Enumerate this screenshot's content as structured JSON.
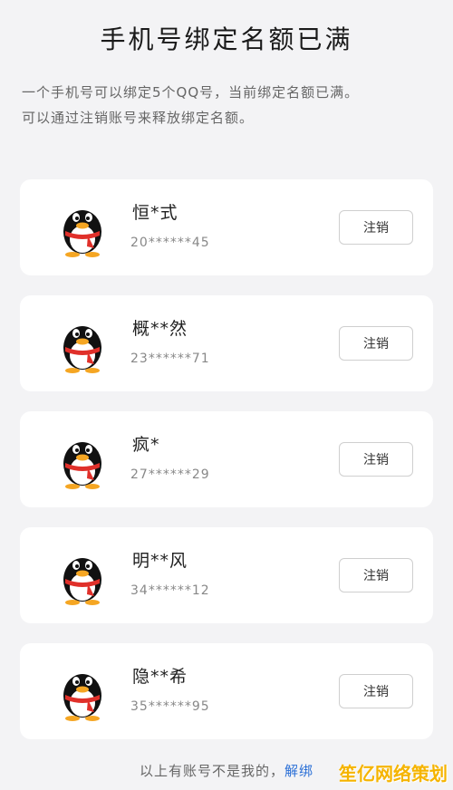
{
  "header": {
    "title": "手机号绑定名额已满"
  },
  "description": {
    "line1": "一个手机号可以绑定5个QQ号，当前绑定名额已满。",
    "line2": "可以通过注销账号来释放绑定名额。"
  },
  "accounts": [
    {
      "name": "恒*式",
      "number": "20******45",
      "button": "注销",
      "avatar_icon": "qq-penguin-icon"
    },
    {
      "name": "概**然",
      "number": "23******71",
      "button": "注销",
      "avatar_icon": "qq-penguin-icon"
    },
    {
      "name": "疯*",
      "number": "27******29",
      "button": "注销",
      "avatar_icon": "qq-penguin-icon"
    },
    {
      "name": "明**风",
      "number": "34******12",
      "button": "注销",
      "avatar_icon": "qq-penguin-icon"
    },
    {
      "name": "隐**希",
      "number": "35******95",
      "button": "注销",
      "avatar_icon": "qq-penguin-icon"
    }
  ],
  "footer": {
    "text": "以上有账号不是我的，",
    "link": "解绑"
  },
  "watermark": {
    "text": "笙亿网络策划"
  },
  "colors": {
    "link": "#2a6fd6",
    "scarf": "#e0302a",
    "beak": "#f5a623",
    "background": "#f3f3f5"
  }
}
